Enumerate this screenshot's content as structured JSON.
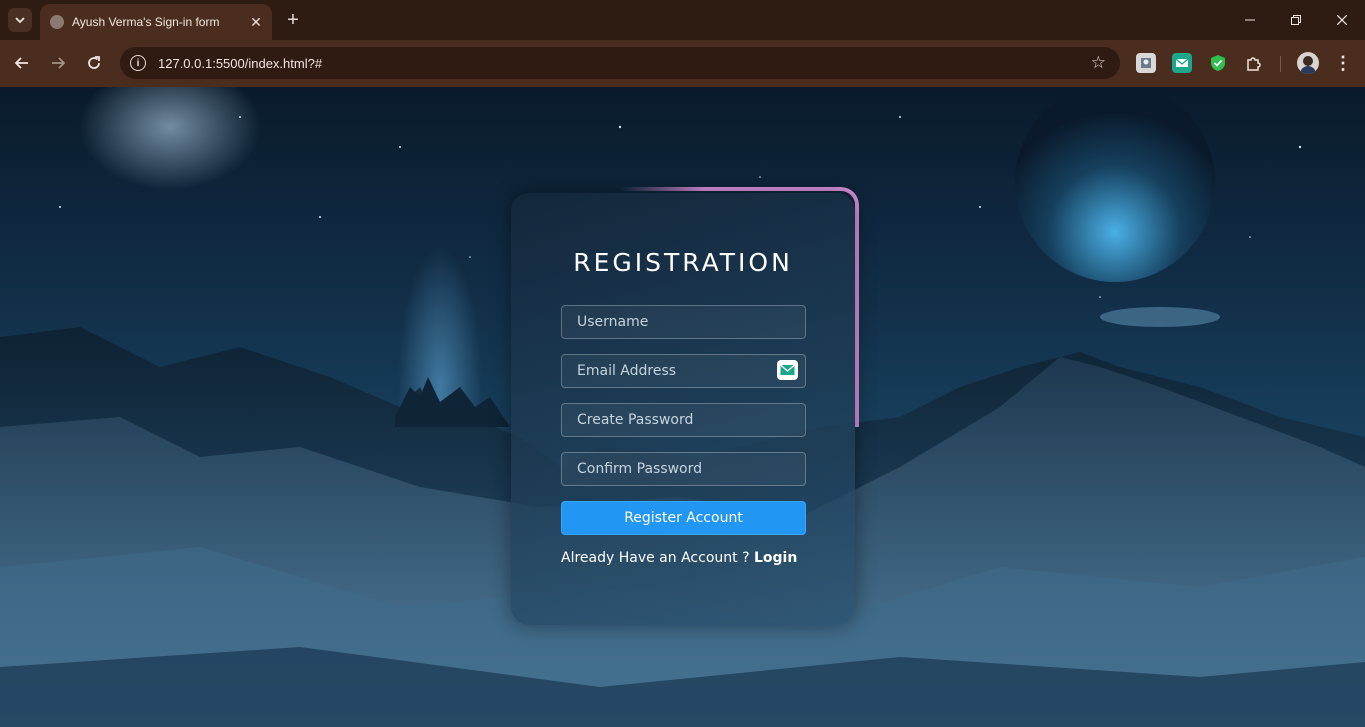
{
  "browser": {
    "tab_title": "Ayush Verma's Sign-in form",
    "url": "127.0.0.1:5500/index.html?#"
  },
  "form": {
    "title": "REGISTRATION",
    "username_placeholder": "Username",
    "email_placeholder": "Email Address",
    "password_placeholder": "Create Password",
    "confirm_placeholder": "Confirm Password",
    "register_label": "Register Account",
    "already_text": "Already Have an Account ?",
    "login_label": "Login"
  },
  "colors": {
    "accent_button": "#2196f3",
    "glow_border": "#d68fd8",
    "chrome_bg": "#4a2d1f"
  }
}
